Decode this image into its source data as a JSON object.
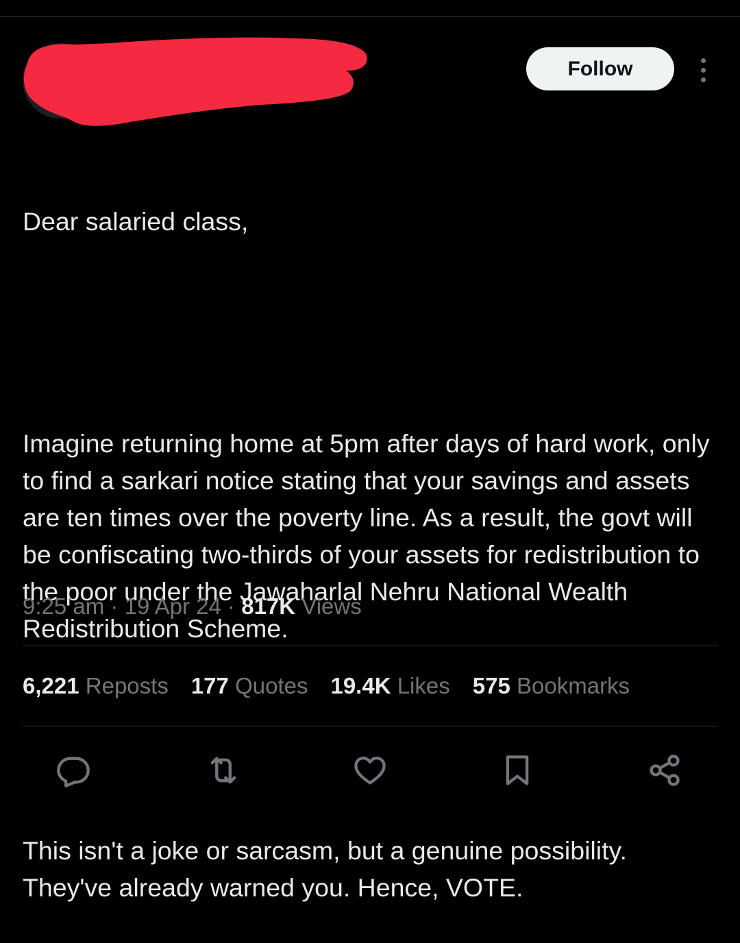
{
  "tweet": {
    "follow_label": "Follow",
    "paragraphs": [
      "Dear salaried class,",
      "Imagine returning home at 5pm after days of hard work, only to find a sarkari notice stating that your savings and assets are ten times over the poverty line. As a result, the govt will be confiscating two-thirds of your assets for redistribution to the poor under the Jawaharlal Nehru National Wealth Redistribution Scheme.",
      "This isn't a joke or sarcasm, but a genuine possibility. They've already warned you. Hence, VOTE."
    ],
    "time": "9:25 am",
    "separator": "·",
    "date": "19 Apr 24",
    "views_count": "817K",
    "views_label": "Views"
  },
  "stats": {
    "reposts_count": "6,221",
    "reposts_label": "Reposts",
    "quotes_count": "177",
    "quotes_label": "Quotes",
    "likes_count": "19.4K",
    "likes_label": "Likes",
    "bookmarks_count": "575",
    "bookmarks_label": "Bookmarks"
  },
  "actions": [
    {
      "icon": "reply-icon"
    },
    {
      "icon": "repost-icon"
    },
    {
      "icon": "like-icon"
    },
    {
      "icon": "bookmark-icon"
    },
    {
      "icon": "share-icon"
    }
  ],
  "colors": {
    "background": "#000000",
    "text": "#e7e9ea",
    "secondary_text": "#71767b",
    "divider": "#2f3336",
    "follow_button_bg": "#eff3f4",
    "redaction": "#f52a40"
  }
}
